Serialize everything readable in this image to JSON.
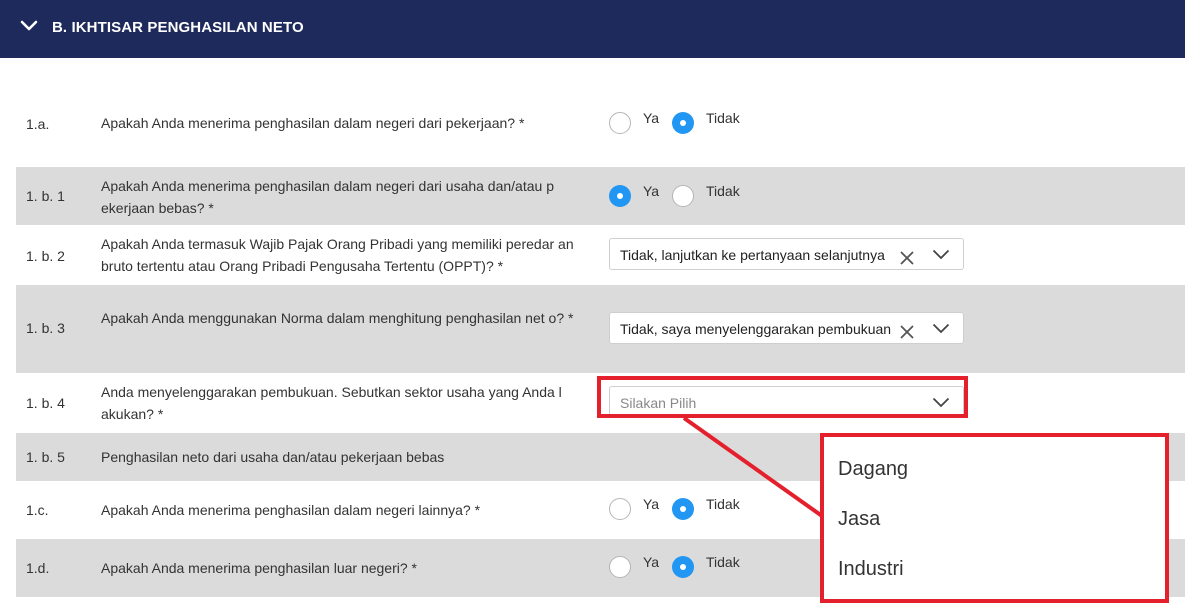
{
  "section": {
    "title": "B. IKHTISAR PENGHASILAN NETO"
  },
  "options": {
    "yes": "Ya",
    "no": "Tidak"
  },
  "questions": [
    {
      "num": "1.a.",
      "text": "Apakah Anda menerima penghasilan dalam negeri dari pekerjaan? *",
      "answer": "Tidak"
    },
    {
      "num": "1. b. 1",
      "text": "Apakah Anda menerima penghasilan dalam negeri dari usaha dan/atau p ekerjaan bebas? *",
      "answer": "Ya"
    },
    {
      "num": "1. b. 2",
      "text": "Apakah Anda termasuk Wajib Pajak Orang Pribadi yang memiliki peredar an bruto tertentu atau Orang Pribadi Pengusaha Tertentu (OPPT)? *",
      "select_value": "Tidak, lanjutkan ke pertanyaan selanjutnya"
    },
    {
      "num": "1. b. 3",
      "text": "Apakah Anda menggunakan Norma dalam menghitung penghasilan net o? *",
      "select_value": "Tidak, saya menyelenggarakan pembukuan"
    },
    {
      "num": "1. b. 4",
      "text": "Anda menyelenggarakan pembukuan. Sebutkan sektor usaha yang Anda l akukan? *",
      "select_placeholder": "Silakan Pilih"
    },
    {
      "num": "1. b. 5",
      "text": "Penghasilan neto dari usaha dan/atau pekerjaan bebas"
    },
    {
      "num": "1.c.",
      "text": "Apakah Anda menerima penghasilan dalam negeri lainnya? *",
      "answer": "Tidak"
    },
    {
      "num": "1.d.",
      "text": "Apakah Anda menerima penghasilan luar negeri? *",
      "answer": "Tidak"
    }
  ],
  "dropdown": {
    "options": [
      "Dagang",
      "Jasa",
      "Industri"
    ]
  },
  "colors": {
    "header_bg": "#1f2a5c",
    "row_shade": "#dbdbdb",
    "radio_selected": "#2196f3",
    "highlight": "#e3202b"
  },
  "icons": {
    "section_toggle": "chevron-down-icon",
    "clear": "close-icon",
    "dropdown": "chevron-down-icon"
  }
}
